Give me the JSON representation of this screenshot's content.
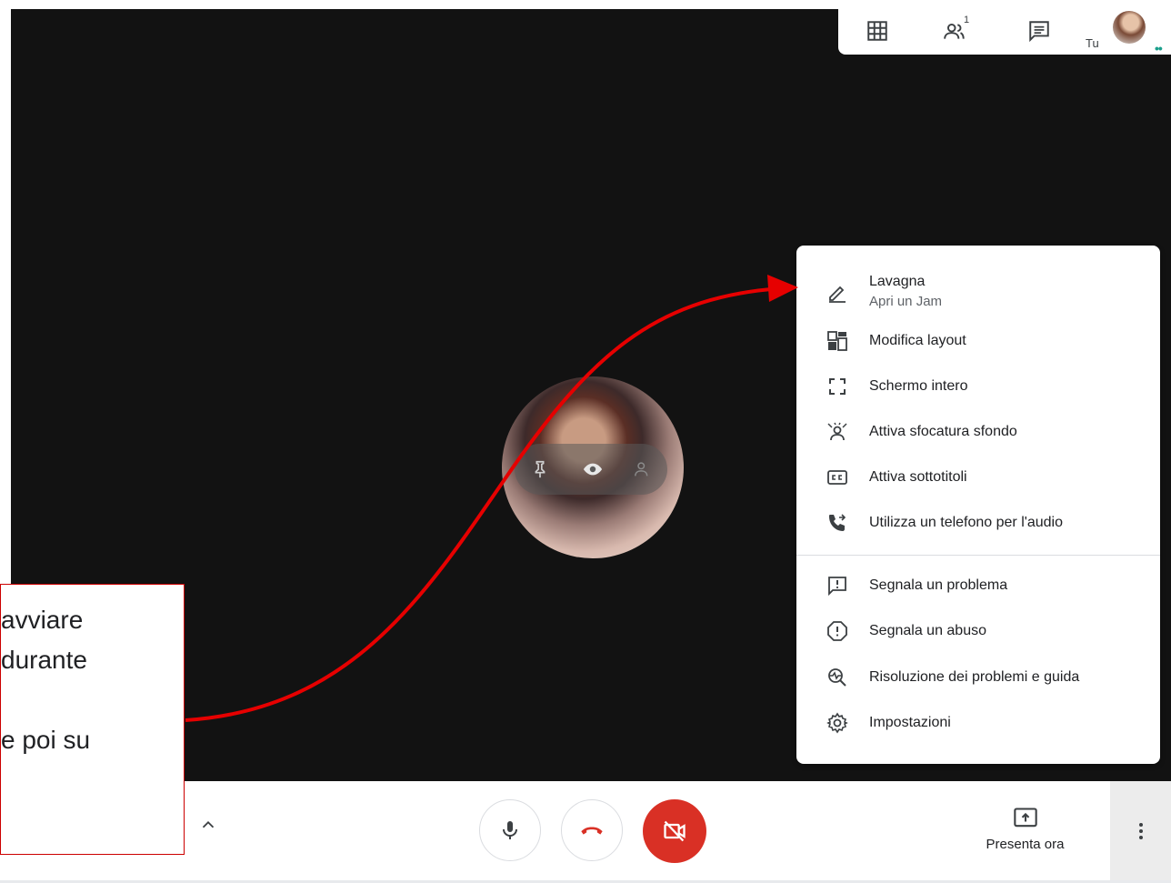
{
  "topbar": {
    "participants_count": "1",
    "self_label": "Tu",
    "icons": [
      "grid-icon",
      "people-icon",
      "chat-icon",
      "avatar"
    ]
  },
  "menu": {
    "items": [
      {
        "label": "Lavagna",
        "sub": "Apri un Jam",
        "icon": "pen-icon"
      },
      {
        "label": "Modifica layout",
        "icon": "layout-icon"
      },
      {
        "label": "Schermo intero",
        "icon": "fullscreen-icon"
      },
      {
        "label": "Attiva sfocatura sfondo",
        "icon": "blur-icon"
      },
      {
        "label": "Attiva sottotitoli",
        "icon": "captions-icon"
      },
      {
        "label": "Utilizza un telefono per l'audio",
        "icon": "phone-icon"
      },
      {
        "label": "Segnala un problema",
        "icon": "feedback-icon"
      },
      {
        "label": "Segnala un abuso",
        "icon": "report-icon"
      },
      {
        "label": "Risoluzione dei problemi e guida",
        "icon": "troubleshoot-icon"
      },
      {
        "label": "Impostazioni",
        "icon": "settings-icon"
      }
    ]
  },
  "bottombar": {
    "present_label": "Presenta ora"
  },
  "callout": {
    "lines": [
      "avviare",
      "durante",
      "",
      "e poi su"
    ]
  },
  "colors": {
    "stage": "#121212",
    "end_call": "#d93025",
    "annotation": "#e60000",
    "accent_dots": "#1a9f8c"
  }
}
